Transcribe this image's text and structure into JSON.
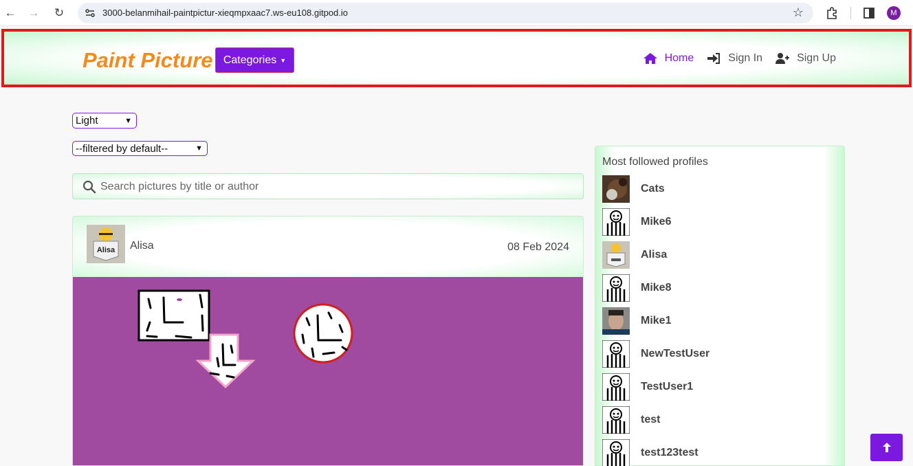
{
  "browser": {
    "url": "3000-belanmihail-paintpictur-xieqmpxaac7.ws-eu108.gitpod.io",
    "profile_initial": "M"
  },
  "header": {
    "brand": "Paint Picture",
    "categories_label": "Categories",
    "nav": {
      "home": "Home",
      "sign_in": "Sign In",
      "sign_up": "Sign Up"
    }
  },
  "controls": {
    "theme_selected": "Light",
    "filter_selected": "--filtered by default--",
    "search_placeholder": "Search pictures by title or author"
  },
  "post": {
    "author": "Alisa",
    "date": "08 Feb 2024"
  },
  "sidebar": {
    "title": "Most followed profiles",
    "profiles": [
      {
        "name": "Cats",
        "avatar": "cat"
      },
      {
        "name": "Mike6",
        "avatar": "default"
      },
      {
        "name": "Alisa",
        "avatar": "alisa"
      },
      {
        "name": "Mike8",
        "avatar": "default"
      },
      {
        "name": "Mike1",
        "avatar": "photo"
      },
      {
        "name": "NewTestUser",
        "avatar": "default"
      },
      {
        "name": "TestUser1",
        "avatar": "default"
      },
      {
        "name": "test",
        "avatar": "default"
      },
      {
        "name": "test123test",
        "avatar": "default"
      }
    ]
  },
  "colors": {
    "accent": "#7b19e0",
    "brand": "#f28a1c",
    "canvas": "#a04aa0",
    "highlight_border": "#e01a1a"
  }
}
